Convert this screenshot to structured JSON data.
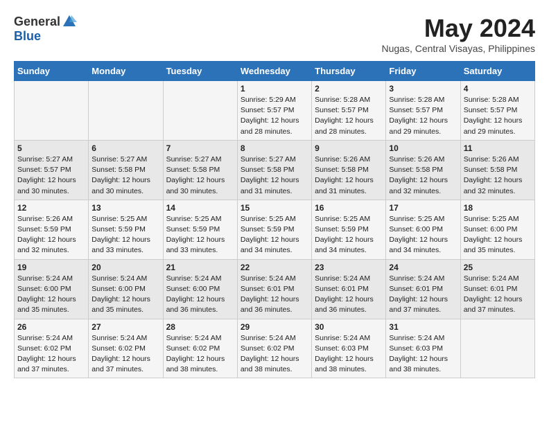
{
  "header": {
    "logo_general": "General",
    "logo_blue": "Blue",
    "month_title": "May 2024",
    "subtitle": "Nugas, Central Visayas, Philippines"
  },
  "weekdays": [
    "Sunday",
    "Monday",
    "Tuesday",
    "Wednesday",
    "Thursday",
    "Friday",
    "Saturday"
  ],
  "weeks": [
    [
      {
        "day": "",
        "content": ""
      },
      {
        "day": "",
        "content": ""
      },
      {
        "day": "",
        "content": ""
      },
      {
        "day": "1",
        "content": "Sunrise: 5:29 AM\nSunset: 5:57 PM\nDaylight: 12 hours\nand 28 minutes."
      },
      {
        "day": "2",
        "content": "Sunrise: 5:28 AM\nSunset: 5:57 PM\nDaylight: 12 hours\nand 28 minutes."
      },
      {
        "day": "3",
        "content": "Sunrise: 5:28 AM\nSunset: 5:57 PM\nDaylight: 12 hours\nand 29 minutes."
      },
      {
        "day": "4",
        "content": "Sunrise: 5:28 AM\nSunset: 5:57 PM\nDaylight: 12 hours\nand 29 minutes."
      }
    ],
    [
      {
        "day": "5",
        "content": "Sunrise: 5:27 AM\nSunset: 5:57 PM\nDaylight: 12 hours\nand 30 minutes."
      },
      {
        "day": "6",
        "content": "Sunrise: 5:27 AM\nSunset: 5:58 PM\nDaylight: 12 hours\nand 30 minutes."
      },
      {
        "day": "7",
        "content": "Sunrise: 5:27 AM\nSunset: 5:58 PM\nDaylight: 12 hours\nand 30 minutes."
      },
      {
        "day": "8",
        "content": "Sunrise: 5:27 AM\nSunset: 5:58 PM\nDaylight: 12 hours\nand 31 minutes."
      },
      {
        "day": "9",
        "content": "Sunrise: 5:26 AM\nSunset: 5:58 PM\nDaylight: 12 hours\nand 31 minutes."
      },
      {
        "day": "10",
        "content": "Sunrise: 5:26 AM\nSunset: 5:58 PM\nDaylight: 12 hours\nand 32 minutes."
      },
      {
        "day": "11",
        "content": "Sunrise: 5:26 AM\nSunset: 5:58 PM\nDaylight: 12 hours\nand 32 minutes."
      }
    ],
    [
      {
        "day": "12",
        "content": "Sunrise: 5:26 AM\nSunset: 5:59 PM\nDaylight: 12 hours\nand 32 minutes."
      },
      {
        "day": "13",
        "content": "Sunrise: 5:25 AM\nSunset: 5:59 PM\nDaylight: 12 hours\nand 33 minutes."
      },
      {
        "day": "14",
        "content": "Sunrise: 5:25 AM\nSunset: 5:59 PM\nDaylight: 12 hours\nand 33 minutes."
      },
      {
        "day": "15",
        "content": "Sunrise: 5:25 AM\nSunset: 5:59 PM\nDaylight: 12 hours\nand 34 minutes."
      },
      {
        "day": "16",
        "content": "Sunrise: 5:25 AM\nSunset: 5:59 PM\nDaylight: 12 hours\nand 34 minutes."
      },
      {
        "day": "17",
        "content": "Sunrise: 5:25 AM\nSunset: 6:00 PM\nDaylight: 12 hours\nand 34 minutes."
      },
      {
        "day": "18",
        "content": "Sunrise: 5:25 AM\nSunset: 6:00 PM\nDaylight: 12 hours\nand 35 minutes."
      }
    ],
    [
      {
        "day": "19",
        "content": "Sunrise: 5:24 AM\nSunset: 6:00 PM\nDaylight: 12 hours\nand 35 minutes."
      },
      {
        "day": "20",
        "content": "Sunrise: 5:24 AM\nSunset: 6:00 PM\nDaylight: 12 hours\nand 35 minutes."
      },
      {
        "day": "21",
        "content": "Sunrise: 5:24 AM\nSunset: 6:00 PM\nDaylight: 12 hours\nand 36 minutes."
      },
      {
        "day": "22",
        "content": "Sunrise: 5:24 AM\nSunset: 6:01 PM\nDaylight: 12 hours\nand 36 minutes."
      },
      {
        "day": "23",
        "content": "Sunrise: 5:24 AM\nSunset: 6:01 PM\nDaylight: 12 hours\nand 36 minutes."
      },
      {
        "day": "24",
        "content": "Sunrise: 5:24 AM\nSunset: 6:01 PM\nDaylight: 12 hours\nand 37 minutes."
      },
      {
        "day": "25",
        "content": "Sunrise: 5:24 AM\nSunset: 6:01 PM\nDaylight: 12 hours\nand 37 minutes."
      }
    ],
    [
      {
        "day": "26",
        "content": "Sunrise: 5:24 AM\nSunset: 6:02 PM\nDaylight: 12 hours\nand 37 minutes."
      },
      {
        "day": "27",
        "content": "Sunrise: 5:24 AM\nSunset: 6:02 PM\nDaylight: 12 hours\nand 37 minutes."
      },
      {
        "day": "28",
        "content": "Sunrise: 5:24 AM\nSunset: 6:02 PM\nDaylight: 12 hours\nand 38 minutes."
      },
      {
        "day": "29",
        "content": "Sunrise: 5:24 AM\nSunset: 6:02 PM\nDaylight: 12 hours\nand 38 minutes."
      },
      {
        "day": "30",
        "content": "Sunrise: 5:24 AM\nSunset: 6:03 PM\nDaylight: 12 hours\nand 38 minutes."
      },
      {
        "day": "31",
        "content": "Sunrise: 5:24 AM\nSunset: 6:03 PM\nDaylight: 12 hours\nand 38 minutes."
      },
      {
        "day": "",
        "content": ""
      }
    ]
  ]
}
